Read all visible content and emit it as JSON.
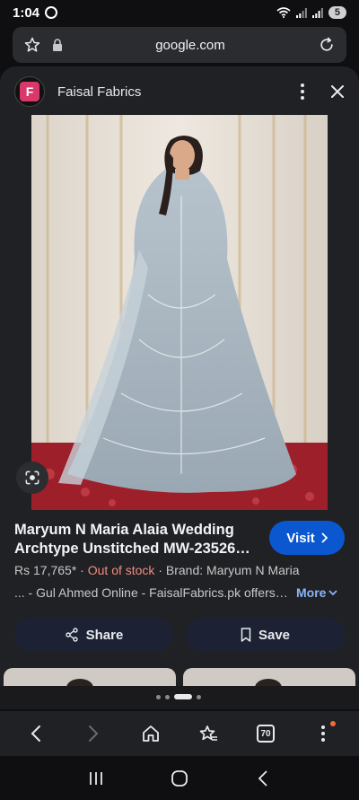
{
  "status": {
    "time": "1:04",
    "battery": "5"
  },
  "browser": {
    "url": "google.com",
    "tabs_count": "70"
  },
  "panel": {
    "site_name": "Faisal Fabrics",
    "site_logo_letter": "F",
    "result_title": "Maryum N Maria Alaia Wedding Archtype Unstitched MW-23526…",
    "visit_label": "Visit",
    "price": "Rs 17,765*",
    "stock_status": "Out of stock",
    "brand": "Brand: Maryum N Maria",
    "description": "... - Gul Ahmed Online - FaisalFabrics.pk offers…",
    "more_label": "More",
    "share_label": "Share",
    "save_label": "Save"
  },
  "colors": {
    "panel_bg": "#202124",
    "visit_blue": "#0b57d0",
    "stock_red": "#f28b82",
    "more_blue": "#8ab4f8",
    "action_bg": "#1c2233"
  },
  "icons": [
    "whatsapp-icon",
    "wifi-icon",
    "signal-icon",
    "bookmark-star-icon",
    "lock-icon",
    "reload-icon",
    "more-vert-icon",
    "close-icon",
    "lens-icon",
    "chevron-right-icon",
    "chevron-down-icon",
    "share-icon",
    "bookmark-icon",
    "back-icon",
    "forward-icon",
    "home-icon",
    "favorites-icon",
    "tabs-icon",
    "menu-icon",
    "recents-icon",
    "home-nav-icon",
    "back-nav-icon"
  ]
}
